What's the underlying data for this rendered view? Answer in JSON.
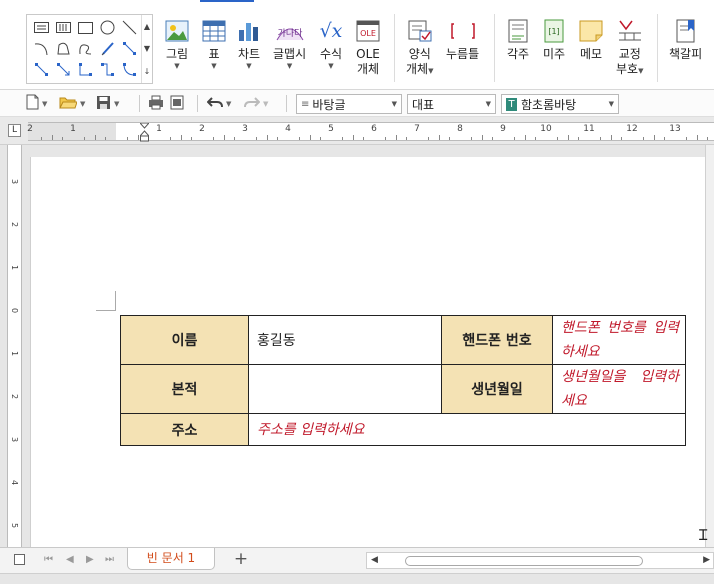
{
  "ribbon": {
    "buttons": [
      {
        "label": "그림",
        "icon": "picture-icon",
        "has_arrow": true
      },
      {
        "label": "표",
        "icon": "table-icon",
        "has_arrow": true
      },
      {
        "label": "차트",
        "icon": "chart-icon",
        "has_arrow": true
      },
      {
        "label": "글맵시",
        "icon": "wordart-icon",
        "has_arrow": true
      },
      {
        "label": "수식",
        "icon": "formula-icon",
        "has_arrow": true
      },
      {
        "label": "OLE",
        "label2": "개체",
        "icon": "ole-object-icon",
        "has_arrow": false
      },
      {
        "label": "양식",
        "label2": "개체",
        "icon": "form-object-icon",
        "has_arrow": true
      },
      {
        "label": "누름틀",
        "icon": "click-field-icon",
        "has_arrow": false
      },
      {
        "label": "각주",
        "icon": "footnote-icon",
        "has_arrow": false
      },
      {
        "label": "미주",
        "icon": "endnote-icon",
        "has_arrow": false
      },
      {
        "label": "메모",
        "icon": "memo-icon",
        "has_arrow": false
      },
      {
        "label": "교정",
        "label2": "부호",
        "icon": "proofreading-icon",
        "has_arrow": true
      },
      {
        "label": "책갈피",
        "icon": "bookmark-icon",
        "has_arrow": false
      }
    ],
    "wordart_icon_text": "가나다",
    "formula_icon_text": "√x",
    "ole_icon_text": "OLE",
    "endnote_icon_text": "[1]"
  },
  "toolbar": {
    "style_combo": "바탕글",
    "style_icon_text": "≡",
    "outline_combo": "대표",
    "font_combo": "함초롬바탕",
    "font_icon_text": "T"
  },
  "ruler": {
    "h_labels": [
      "2",
      "1",
      "1",
      "2",
      "3",
      "4",
      "5",
      "6",
      "7",
      "8",
      "9",
      "10",
      "11",
      "12",
      "13"
    ],
    "v_labels": [
      "3",
      "2",
      "1",
      "0",
      "1",
      "2",
      "3",
      "4",
      "5"
    ],
    "corner_symbol": "L"
  },
  "document": {
    "table": {
      "rows": [
        {
          "label1": "이름",
          "value1": "홍길동",
          "label2": "핸드폰 번호",
          "hint2": "핸드폰 번호를 입력하세요"
        },
        {
          "label1": "본적",
          "value1": "",
          "label2": "생년월일",
          "hint2": "생년월일을 입력하세요"
        },
        {
          "label1": "주소",
          "hint_wide": "주소를 입력하세요"
        }
      ]
    }
  },
  "bottom": {
    "doc_tab": "빈 문서 1",
    "add_tab": "+",
    "nav_first": "⏮",
    "nav_prev": "◀",
    "nav_next": "▶",
    "nav_last": "⏭"
  },
  "colors": {
    "label_cell_bg": "#f4e2b4",
    "hint_text": "#c0182a",
    "doc_tab_text": "#d24b1a",
    "accent": "#2a64c8"
  }
}
